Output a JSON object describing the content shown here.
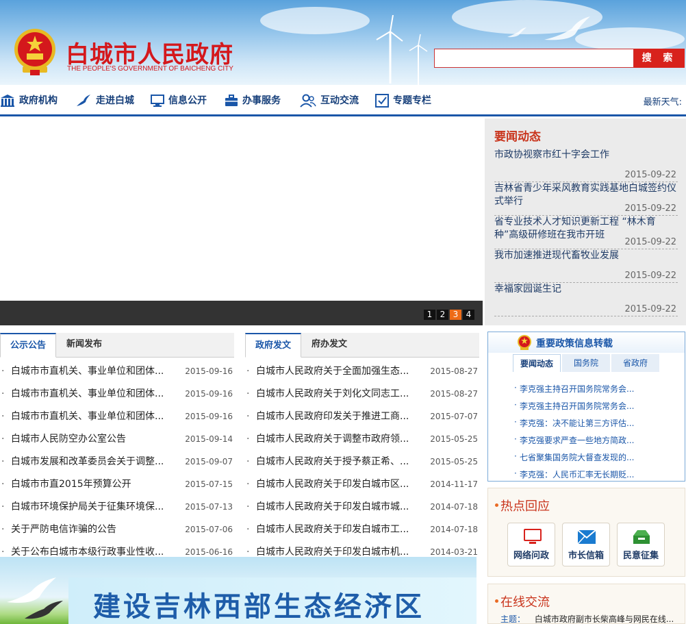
{
  "header": {
    "title": "白城市人民政府",
    "subtitle": "THE PEOPLE'S GOVERNMENT OF BAICHENG CITY",
    "search_placeholder": "",
    "search_label": "搜 索"
  },
  "nav": {
    "items": [
      {
        "label": "政府机构",
        "icon": "building-icon"
      },
      {
        "label": "走进白城",
        "icon": "crane-icon"
      },
      {
        "label": "信息公开",
        "icon": "monitor-icon"
      },
      {
        "label": "办事服务",
        "icon": "briefcase-icon"
      },
      {
        "label": "互动交流",
        "icon": "people-icon"
      },
      {
        "label": "专题专栏",
        "icon": "checklist-icon"
      }
    ],
    "weather": "最新天气:"
  },
  "slider": {
    "pages": [
      "1",
      "2",
      "3",
      "4"
    ],
    "active_page": "3"
  },
  "news": {
    "title": "要闻动态",
    "items": [
      {
        "text": "市政协视察市红十字会工作",
        "date": "2015-09-22"
      },
      {
        "text": "吉林省青少年采风教育实践基地白城签约仪式举行",
        "date": "2015-09-22"
      },
      {
        "text": "省专业技术人才知识更新工程 “林木育种”高级研修班在我市开班",
        "date": "2015-09-22"
      },
      {
        "text": "我市加速推进现代畜牧业发展",
        "date": "2015-09-22"
      },
      {
        "text": "幸福家园诞生记",
        "date": "2015-09-22"
      }
    ]
  },
  "notices": {
    "tabs": [
      "公示公告",
      "新闻发布"
    ],
    "rows": [
      {
        "text": "白城市市直机关、事业单位和团体...",
        "date": "2015-09-16"
      },
      {
        "text": "白城市市直机关、事业单位和团体...",
        "date": "2015-09-16"
      },
      {
        "text": "白城市市直机关、事业单位和团体...",
        "date": "2015-09-16"
      },
      {
        "text": "白城市人民防空办公室公告",
        "date": "2015-09-14"
      },
      {
        "text": "白城市发展和改革委员会关于调整...",
        "date": "2015-09-07"
      },
      {
        "text": "白城市市直2015年预算公开",
        "date": "2015-07-15"
      },
      {
        "text": "白城市环境保护局关于征集环境保...",
        "date": "2015-07-13"
      },
      {
        "text": "关于严防电信诈骗的公告",
        "date": "2015-07-06"
      },
      {
        "text": "关于公布白城市本级行政事业性收...",
        "date": "2015-06-16"
      }
    ]
  },
  "docs": {
    "tabs": [
      "政府发文",
      "府办发文"
    ],
    "rows": [
      {
        "text": "白城市人民政府关于全面加强生态...",
        "date": "2015-08-27"
      },
      {
        "text": "白城市人民政府关于刘化文同志工...",
        "date": "2015-08-27"
      },
      {
        "text": "白城市人民政府印发关于推进工商...",
        "date": "2015-07-07"
      },
      {
        "text": "白城市人民政府关于调整市政府领...",
        "date": "2015-05-25"
      },
      {
        "text": "白城市人民政府关于授予蔡正希、...",
        "date": "2015-05-25"
      },
      {
        "text": "白城市人民政府关于印发白城市区...",
        "date": "2014-11-17"
      },
      {
        "text": "白城市人民政府关于印发白城市城...",
        "date": "2014-07-18"
      },
      {
        "text": "白城市人民政府关于印发白城市工...",
        "date": "2014-07-18"
      },
      {
        "text": "白城市人民政府关于印发白城市机...",
        "date": "2014-03-21"
      }
    ]
  },
  "banner": {
    "text": "建设吉林西部生态经济区"
  },
  "policy": {
    "title": "重要政策信息转载",
    "tabs": [
      "要闻动态",
      "国务院",
      "省政府"
    ],
    "links": [
      "李克强主持召开国务院常务会...",
      "李克强主持召开国务院常务会...",
      "李克强：决不能让第三方评估...",
      "李克强要求严查一些地方简政...",
      "七省聚集国务院大督查发现的...",
      "李克强：人民币汇率无长期贬..."
    ]
  },
  "hot": {
    "title": "热点回应",
    "buttons": [
      {
        "label": "网络问政",
        "icon": "monitor-icon"
      },
      {
        "label": "市长信箱",
        "icon": "envelope-icon"
      },
      {
        "label": "民意征集",
        "icon": "inbox-icon"
      }
    ]
  },
  "online": {
    "title": "在线交流",
    "topic_label": "主题：",
    "topic_text": "白城市政府副市长柴高峰与网民在线..."
  },
  "colors": {
    "brand_red": "#d4181c",
    "nav_blue": "#163f7a",
    "accent_orange": "#ee6b17"
  }
}
